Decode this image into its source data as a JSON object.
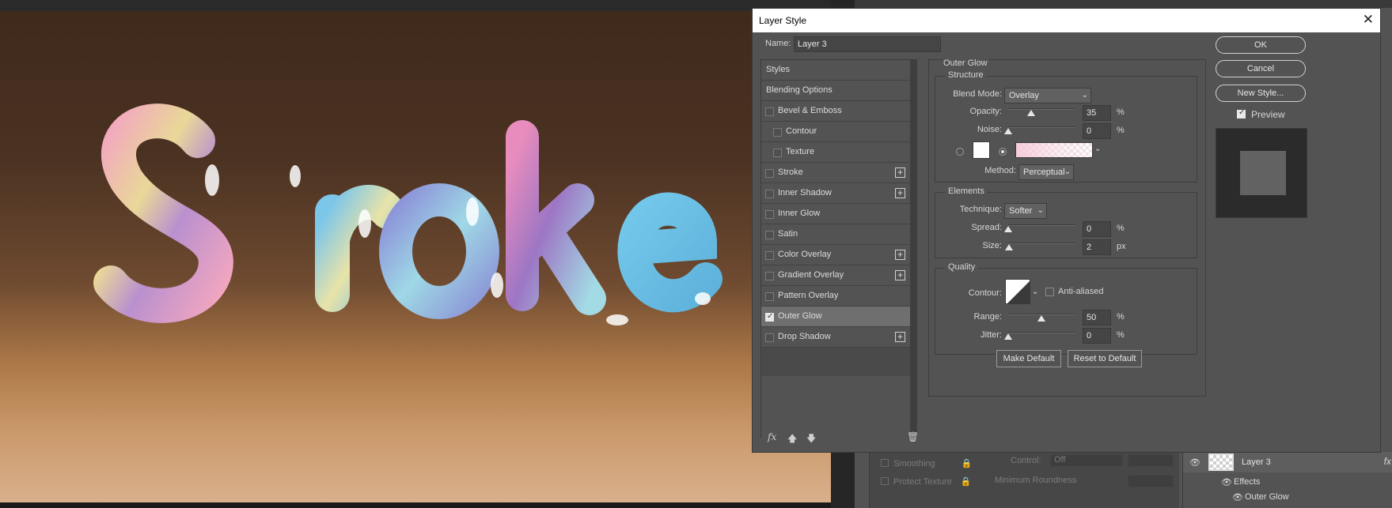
{
  "dialog": {
    "title": "Layer Style",
    "name_label": "Name:",
    "name_value": "Layer 3"
  },
  "styles_list": {
    "items": [
      {
        "label": "Styles",
        "type": "header"
      },
      {
        "label": "Blending Options",
        "type": "header"
      },
      {
        "label": "Bevel & Emboss",
        "checked": false,
        "plus": false
      },
      {
        "label": "Contour",
        "checked": false,
        "plus": false,
        "indent": true
      },
      {
        "label": "Texture",
        "checked": false,
        "plus": false,
        "indent": true
      },
      {
        "label": "Stroke",
        "checked": false,
        "plus": true
      },
      {
        "label": "Inner Shadow",
        "checked": false,
        "plus": true
      },
      {
        "label": "Inner Glow",
        "checked": false,
        "plus": false
      },
      {
        "label": "Satin",
        "checked": false,
        "plus": false
      },
      {
        "label": "Color Overlay",
        "checked": false,
        "plus": true
      },
      {
        "label": "Gradient Overlay",
        "checked": false,
        "plus": true
      },
      {
        "label": "Pattern Overlay",
        "checked": false,
        "plus": false
      },
      {
        "label": "Outer Glow",
        "checked": true,
        "plus": false,
        "selected": true
      },
      {
        "label": "Drop Shadow",
        "checked": false,
        "plus": true
      }
    ],
    "footer_icons": [
      "fx-icon",
      "move-up-icon",
      "move-down-icon",
      "trash-icon"
    ],
    "fx_label": "fx"
  },
  "outer_glow": {
    "title": "Outer Glow",
    "structure": {
      "title": "Structure",
      "blend_mode_label": "Blend Mode:",
      "blend_mode": "Overlay",
      "opacity_label": "Opacity:",
      "opacity": "35",
      "opacity_fraction": 0.35,
      "noise_label": "Noise:",
      "noise": "0",
      "noise_fraction": 0,
      "percent": "%",
      "method_label": "Method:",
      "method": "Perceptual"
    },
    "elements": {
      "title": "Elements",
      "technique_label": "Technique:",
      "technique": "Softer",
      "spread_label": "Spread:",
      "spread": "0",
      "spread_fraction": 0,
      "size_label": "Size:",
      "size": "2",
      "size_fraction": 0.01,
      "percent": "%",
      "px": "px"
    },
    "quality": {
      "title": "Quality",
      "contour_label": "Contour:",
      "anti_aliased_label": "Anti-aliased",
      "range_label": "Range:",
      "range": "50",
      "range_fraction": 0.5,
      "jitter_label": "Jitter:",
      "jitter": "0",
      "jitter_fraction": 0,
      "percent": "%"
    },
    "make_default": "Make Default",
    "reset_default": "Reset to Default"
  },
  "actions": {
    "ok": "OK",
    "cancel": "Cancel",
    "new_style": "New Style...",
    "preview_label": "Preview",
    "preview_checked": true
  },
  "canvas": {
    "text": "Stroke"
  },
  "brush_options": {
    "smoothing": "Smoothing",
    "protect_texture": "Protect Texture",
    "control_label": "Control:",
    "control_value": "Off",
    "minimum_roundness": "Minimum Roundness"
  },
  "layers": {
    "layer_name": "Layer 3",
    "effects": "Effects",
    "effect_item": "Outer Glow",
    "fx": "fx"
  },
  "colors": {
    "dialog_bg": "#535353",
    "titlebar_bg": "#ffffff",
    "selected_row": "#6f6f6f"
  }
}
